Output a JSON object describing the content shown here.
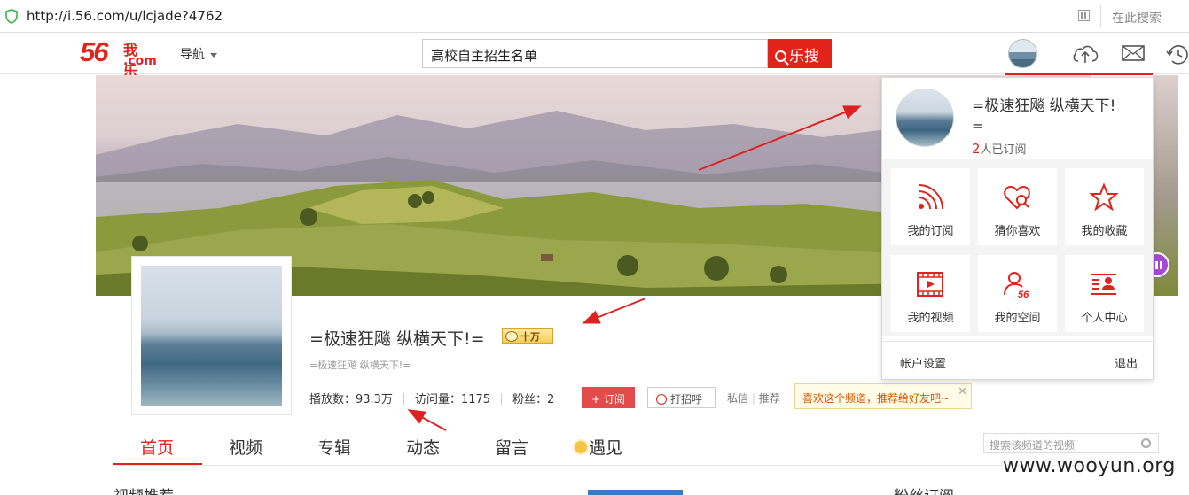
{
  "browser": {
    "url": "http://i.56.com/u/lcjade?4762",
    "search_placeholder": "在此搜索"
  },
  "header": {
    "logo_number": "56",
    "logo_cn": "我乐",
    "logo_com": ".com",
    "nav_label": "导航",
    "search_value": "高校自主招生名单",
    "search_button": "乐搜"
  },
  "profile": {
    "name": "=极速狂飚 纵横天下!=",
    "badge": "十万",
    "subtitle": "=极速狂飚 纵横天下!=",
    "plays_label": "播放数：93.3万",
    "visits_label": "访问量：1175",
    "fans_label": "粉丝：2",
    "subscribe_button": "订阅",
    "hi_button": "打招呼",
    "message_link": "私信",
    "recommend_link": "推荐",
    "tip": "喜欢这个频道，推荐给好友吧~"
  },
  "tabs": [
    {
      "label": "首页"
    },
    {
      "label": "视频"
    },
    {
      "label": "专辑"
    },
    {
      "label": "动态"
    },
    {
      "label": "留言"
    },
    {
      "label": "遇见"
    }
  ],
  "channel_search_placeholder": "搜索该频道的视频",
  "sections": {
    "left_title": "视频推荐",
    "right_title": "粉丝订阅"
  },
  "dropdown": {
    "name": "=极速狂飚 纵横天下!",
    "name_tail": "=",
    "subscribers_count": "2",
    "subscribers_text": "人已订阅",
    "items": [
      {
        "label": "我的订阅",
        "icon": "rss-icon"
      },
      {
        "label": "猜你喜欢",
        "icon": "heart-search-icon"
      },
      {
        "label": "我的收藏",
        "icon": "star-icon"
      },
      {
        "label": "我的视频",
        "icon": "film-icon"
      },
      {
        "label": "我的空间",
        "icon": "user-56-icon"
      },
      {
        "label": "个人中心",
        "icon": "profile-card-icon"
      }
    ],
    "account_settings": "帐户设置",
    "logout": "退出"
  },
  "watermark": "www.wooyun.org",
  "colors": {
    "brand_red": "#e2231a",
    "annotation_red": "#e02020"
  }
}
